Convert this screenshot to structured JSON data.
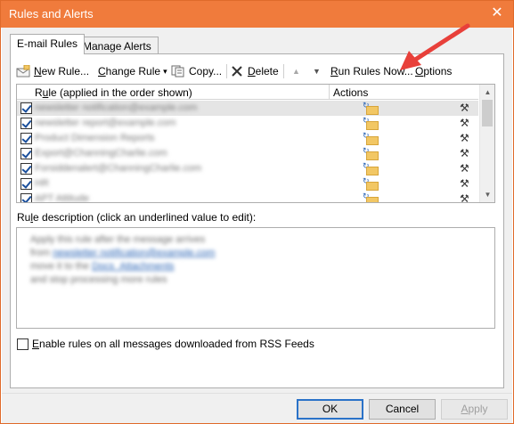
{
  "window": {
    "title": "Rules and Alerts",
    "close_glyph": "✕"
  },
  "tabs": [
    {
      "label": "E-mail Rules",
      "active": true
    },
    {
      "label": "Manage Alerts",
      "active": false
    }
  ],
  "toolbar": {
    "new_rule": {
      "pre": "",
      "u": "N",
      "post": "ew Rule..."
    },
    "change_rule": {
      "pre": "",
      "u": "C",
      "post": "hange Rule"
    },
    "copy": {
      "pre": "",
      "u": "",
      "post": "Copy..."
    },
    "delete": {
      "pre": "",
      "u": "D",
      "post": "elete"
    },
    "run_rules": {
      "pre": "",
      "u": "R",
      "post": "un Rules Now..."
    },
    "options": {
      "pre": "",
      "u": "O",
      "post": "ptions"
    },
    "dropdown_glyph": "▾",
    "up_glyph": "▲",
    "down_glyph": "▼"
  },
  "rules_list": {
    "col_rule": {
      "pre": "R",
      "u": "u",
      "post": "le (applied in the order shown)"
    },
    "col_actions": "Actions",
    "rows": [
      {
        "name": "newsletter notification@example.com",
        "checked": true,
        "selected": true
      },
      {
        "name": "newsletter report@example.com",
        "checked": true,
        "selected": false
      },
      {
        "name": "Product Dimension Reports",
        "checked": true,
        "selected": false
      },
      {
        "name": "Export@ChanningCharlie.com",
        "checked": true,
        "selected": false
      },
      {
        "name": "Forsiddenalert@ChanningCharlie.com",
        "checked": true,
        "selected": false
      },
      {
        "name": "HR",
        "checked": true,
        "selected": false
      },
      {
        "name": "APT Attitude",
        "checked": true,
        "selected": false
      }
    ],
    "action_arrow_glyph": "↻",
    "tools_glyph": "⚒"
  },
  "description": {
    "label": {
      "pre": "Ru",
      "u": "l",
      "post": "e description (click an underlined value to edit):"
    },
    "lines": [
      {
        "text": "Apply this rule after the message arrives",
        "link": ""
      },
      {
        "text": "from ",
        "link": "newsletter notification@example.com"
      },
      {
        "text": "move it to the ",
        "link": "Docs_Attachments"
      },
      {
        "text": " and stop processing more rules",
        "link": ""
      }
    ]
  },
  "rss_option": {
    "pre": "",
    "u": "E",
    "post": "nable rules on all messages downloaded from RSS Feeds",
    "checked": false
  },
  "buttons": {
    "ok": "OK",
    "cancel": "Cancel",
    "apply": {
      "pre": "",
      "u": "A",
      "post": "pply"
    }
  },
  "colors": {
    "titlebar": "#f07b3c",
    "annotation_arrow": "#e8403a",
    "checkbox_mark": "#1a4f9c",
    "link": "#2a64b5"
  }
}
